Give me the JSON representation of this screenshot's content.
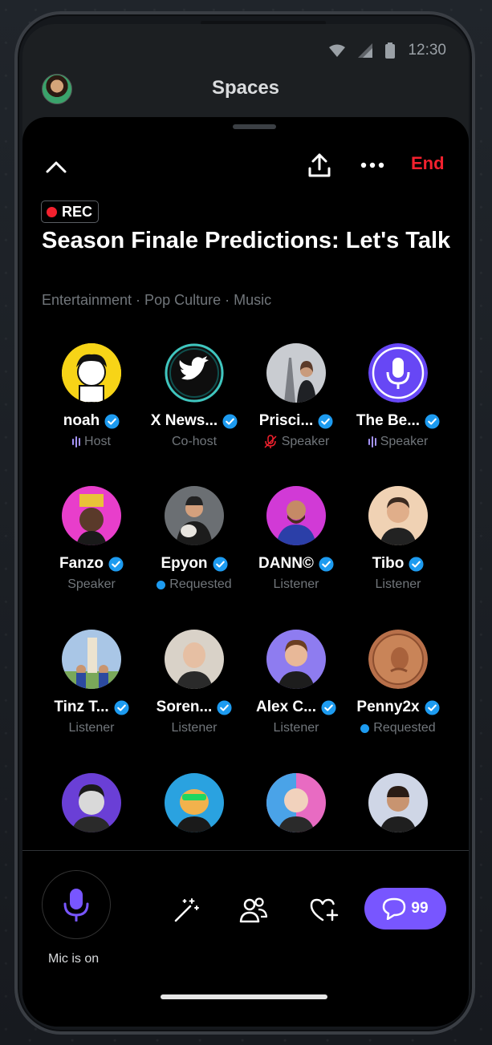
{
  "status_bar": {
    "time": "12:30"
  },
  "header": {
    "title": "Spaces"
  },
  "toolbar": {
    "end_label": "End"
  },
  "space": {
    "rec_label": "REC",
    "title": "Season Finale Predictions: Let's Talk",
    "topics": "Entertainment · Pop Culture · Music"
  },
  "participants": [
    {
      "name": "noah",
      "role": "Host",
      "role_icon": "speaking-bars"
    },
    {
      "name": "X News...",
      "role": "Co-host",
      "role_icon": ""
    },
    {
      "name": "Prisci...",
      "role": "Speaker",
      "role_icon": "mic-muted"
    },
    {
      "name": "The Be...",
      "role": "Speaker",
      "role_icon": "speaking-bars"
    },
    {
      "name": "Fanzo",
      "role": "Speaker",
      "role_icon": ""
    },
    {
      "name": "Epyon",
      "role": "Requested",
      "role_icon": "requested-dot"
    },
    {
      "name": "DANN©",
      "role": "Listener",
      "role_icon": ""
    },
    {
      "name": "Tibo",
      "role": "Listener",
      "role_icon": ""
    },
    {
      "name": "Tinz T...",
      "role": "Listener",
      "role_icon": ""
    },
    {
      "name": "Soren...",
      "role": "Listener",
      "role_icon": ""
    },
    {
      "name": "Alex C...",
      "role": "Listener",
      "role_icon": ""
    },
    {
      "name": "Penny2x",
      "role": "Requested",
      "role_icon": "requested-dot"
    }
  ],
  "bottom_bar": {
    "mic_label": "Mic is on",
    "comment_count": "99"
  },
  "colors": {
    "accent_purple": "#7856ff",
    "end_red": "#f4212e",
    "verified_blue": "#1d9bf0"
  }
}
